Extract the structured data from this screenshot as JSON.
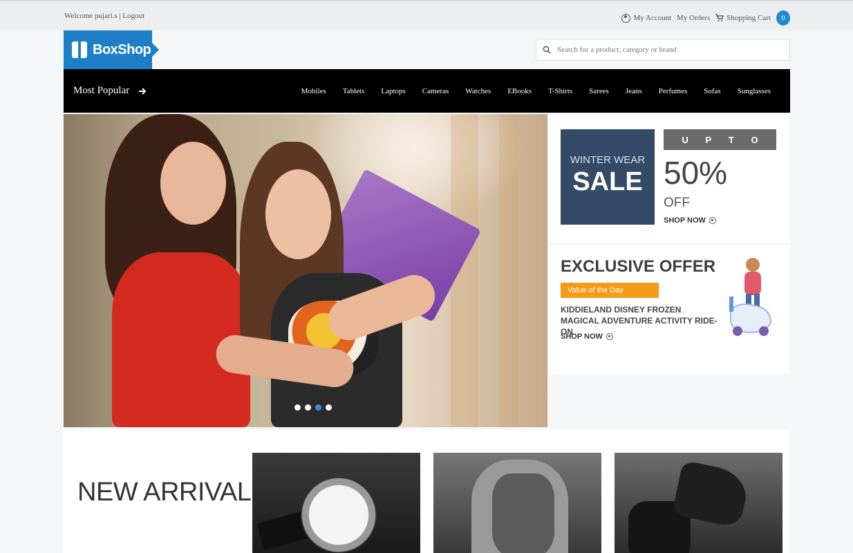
{
  "topbar": {
    "welcome": "Welcome pujari.s | ",
    "logout": "Logout",
    "my_account": "My Account",
    "my_orders": "My Orders",
    "shopping_cart": "Shopping Cart",
    "cart_count": "0"
  },
  "header": {
    "logo_text": "BoxShop",
    "search_placeholder": "Search for a product, category or brand"
  },
  "nav": {
    "most_popular": "Most Popular",
    "items": [
      "Mobiles",
      "Tablets",
      "Laptops",
      "Cameras",
      "Watches",
      "EBooks",
      "T-Shirts",
      "Sarees",
      "Jeans",
      "Perfumes",
      "Sofas",
      "Sunglasses"
    ]
  },
  "promo_sale": {
    "line1": "WINTER WEAR",
    "line2": "SALE",
    "upto": [
      "U",
      "P",
      "T",
      "O"
    ],
    "percent": "50%",
    "off": "OFF",
    "shop_now": "SHOP NOW"
  },
  "promo_exclusive": {
    "title": "EXCLUSIVE OFFER",
    "badge": "Value of the Day",
    "description": "KIDDIELAND DISNEY FROZEN MAGICAL ADVENTURE ACTIVITY RIDE-ON",
    "shop_now": "SHOP NOW"
  },
  "carousel": {
    "slide_count": 4,
    "active_index": 2
  },
  "arrivals": {
    "heading": "NEW ARRIVALS"
  },
  "colors": {
    "brand_blue": "#1e7fc7",
    "cart_badge": "#1e8ad6",
    "sale_panel": "#344a67",
    "value_badge": "#f29c1a",
    "nav_bg": "#000000"
  },
  "icons": [
    "user-icon",
    "cart-icon",
    "search-icon",
    "arrow-right-icon",
    "circle-arrow-icon",
    "box-logo-icon"
  ]
}
